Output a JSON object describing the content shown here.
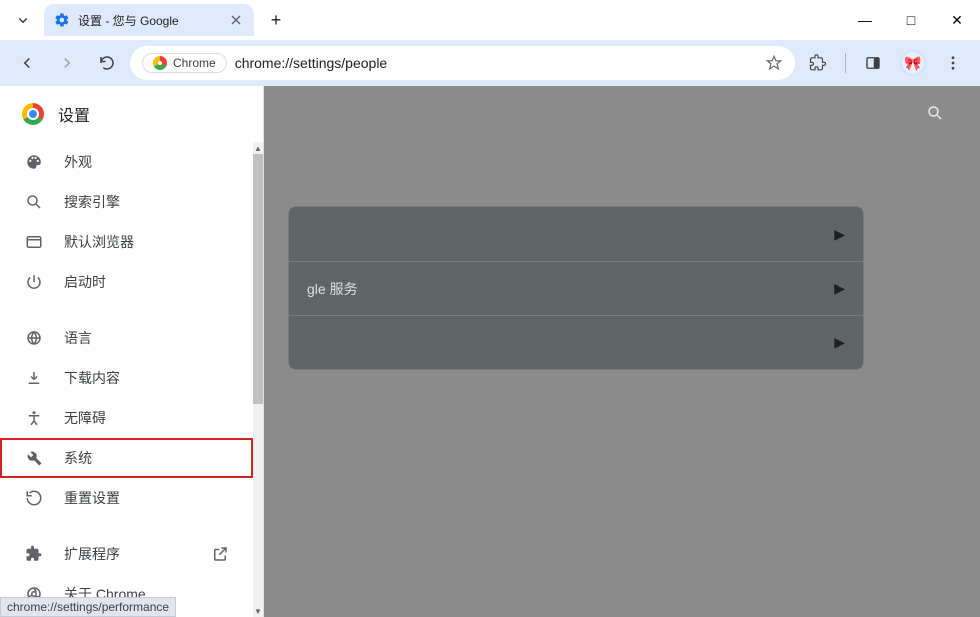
{
  "window": {
    "tab_title": "设置 - 您与 Google",
    "min": "—",
    "max": "□",
    "close": "✕",
    "new_tab": "+"
  },
  "addr": {
    "chip_label": "Chrome",
    "url": "chrome://settings/people"
  },
  "sidebar": {
    "title": "设置",
    "items": [
      {
        "label": "外观"
      },
      {
        "label": "搜索引擎"
      },
      {
        "label": "默认浏览器"
      },
      {
        "label": "启动时"
      },
      {
        "label": "语言"
      },
      {
        "label": "下载内容"
      },
      {
        "label": "无障碍"
      },
      {
        "label": "系统"
      },
      {
        "label": "重置设置"
      },
      {
        "label": "扩展程序"
      },
      {
        "label": "关于 Chrome"
      }
    ]
  },
  "main": {
    "partial_row_label": "gle 服务"
  },
  "status_url": "chrome://settings/performance"
}
